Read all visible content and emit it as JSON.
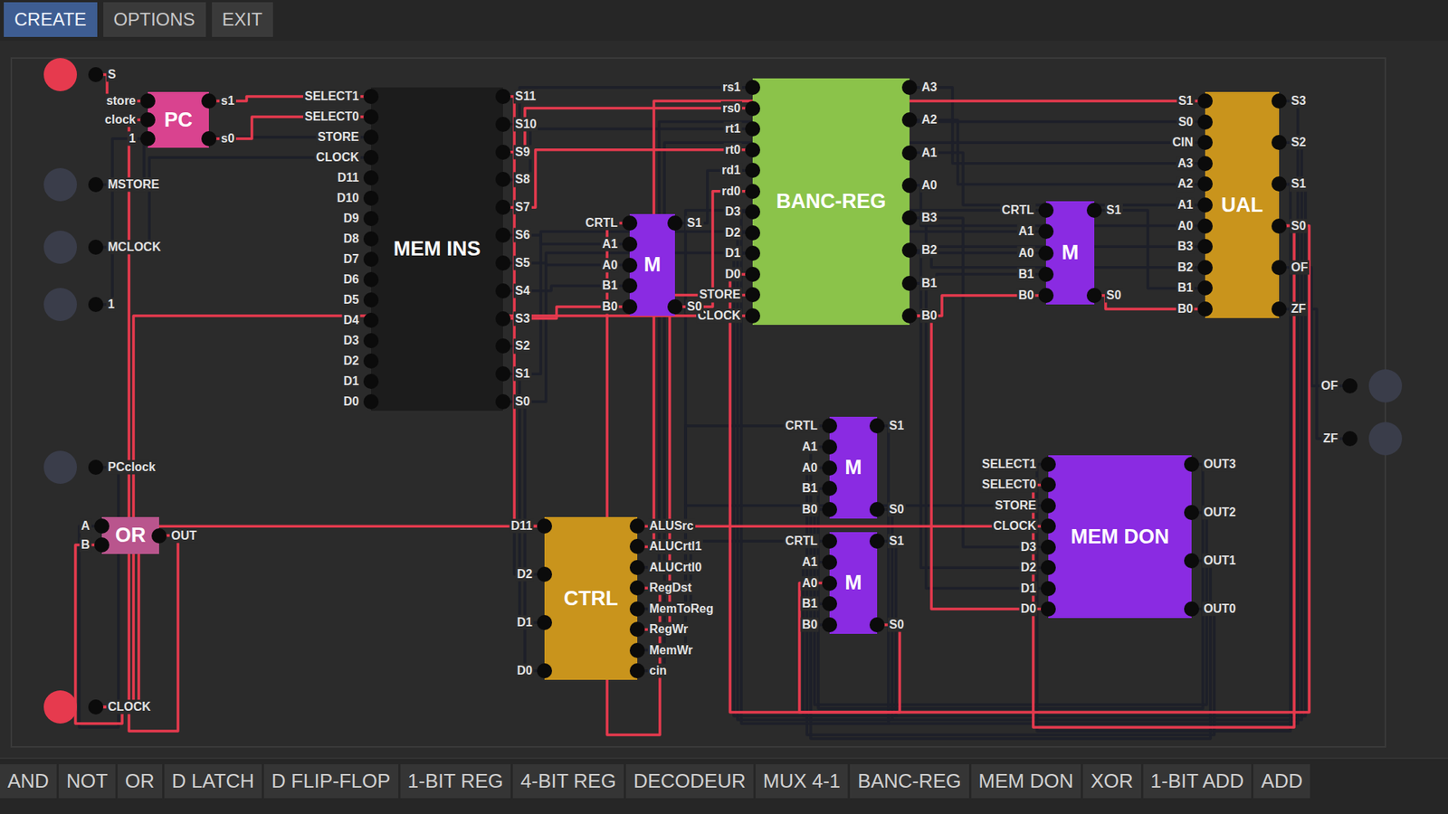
{
  "menu": [
    {
      "label": "CREATE",
      "selected": true
    },
    {
      "label": "OPTIONS",
      "selected": false
    },
    {
      "label": "EXIT",
      "selected": false
    }
  ],
  "inputs": [
    {
      "label": "S",
      "on": true
    },
    {
      "label": "MSTORE",
      "on": false
    },
    {
      "label": "MCLOCK",
      "on": false
    },
    {
      "label": "1",
      "on": false
    },
    {
      "label": "PCclock",
      "on": false
    },
    {
      "label": "CLOCK",
      "on": true
    }
  ],
  "outputs": [
    {
      "label": "OF",
      "on": false
    },
    {
      "label": "ZF",
      "on": false
    }
  ],
  "components": [
    {
      "label": "PC",
      "color": "#d9438f",
      "inputs": [
        "store",
        "clock",
        "1"
      ],
      "outputs": [
        "s1",
        "s0"
      ]
    },
    {
      "label": "OR",
      "color": "#b9558d",
      "inputs": [
        "A",
        "B"
      ],
      "outputs": [
        "OUT"
      ]
    },
    {
      "label": "MEM INS",
      "color": "#1c1c1c",
      "inputs": [
        "SELECT1",
        "SELECT0",
        "STORE",
        "CLOCK",
        "D11",
        "D10",
        "D9",
        "D8",
        "D7",
        "D6",
        "D5",
        "D4",
        "D3",
        "D2",
        "D1",
        "D0"
      ],
      "outputs": [
        "S11",
        "S10",
        "S9",
        "S8",
        "S7",
        "S6",
        "S5",
        "S4",
        "S3",
        "S2",
        "S1",
        "S0"
      ]
    },
    {
      "label": "BANC-REG",
      "color": "#8bc34a",
      "inputs": [
        "rs1",
        "rs0",
        "rt1",
        "rt0",
        "rd1",
        "rd0",
        "D3",
        "D2",
        "D1",
        "D0",
        "STORE",
        "CLOCK"
      ],
      "outputs": [
        "A3",
        "A2",
        "A1",
        "A0",
        "B3",
        "B2",
        "B1",
        "B0"
      ]
    },
    {
      "label": "M",
      "color": "#8a2be2",
      "inputs": [
        "CRTL",
        "A1",
        "A0",
        "B1",
        "B0"
      ],
      "outputs": [
        "S1",
        "S0"
      ]
    },
    {
      "label": "M",
      "color": "#8a2be2",
      "inputs": [
        "CRTL",
        "A1",
        "A0",
        "B1",
        "B0"
      ],
      "outputs": [
        "S1",
        "S0"
      ]
    },
    {
      "label": "UAL",
      "color": "#c9941c",
      "inputs": [
        "S1",
        "S0",
        "CIN",
        "A3",
        "A2",
        "A1",
        "A0",
        "B3",
        "B2",
        "B1",
        "B0"
      ],
      "outputs": [
        "S3",
        "S2",
        "S1",
        "S0",
        "OF",
        "ZF"
      ]
    },
    {
      "label": "M",
      "color": "#8a2be2",
      "inputs": [
        "CRTL",
        "A1",
        "A0",
        "B1",
        "B0"
      ],
      "outputs": [
        "S1",
        "S0"
      ]
    },
    {
      "label": "M",
      "color": "#8a2be2",
      "inputs": [
        "CRTL",
        "A1",
        "A0",
        "B1",
        "B0"
      ],
      "outputs": [
        "S1",
        "S0"
      ]
    },
    {
      "label": "MEM DON",
      "color": "#8a2be2",
      "inputs": [
        "SELECT1",
        "SELECT0",
        "STORE",
        "CLOCK",
        "D3",
        "D2",
        "D1",
        "D0"
      ],
      "outputs": [
        "OUT3",
        "OUT2",
        "OUT1",
        "OUT0"
      ]
    },
    {
      "label": "CTRL",
      "color": "#c9941c",
      "inputs": [
        "D11",
        "D2",
        "D1",
        "D0"
      ],
      "outputs": [
        "ALUSrc",
        "ALUCrtl1",
        "ALUCrtl0",
        "RegDst",
        "MemToReg",
        "RegWr",
        "MemWr",
        "cin"
      ]
    }
  ],
  "wires": [
    {
      "from": "in:0",
      "to": "0:store",
      "on": true
    },
    {
      "from": "in:3",
      "to": "0:1",
      "on": false
    },
    {
      "from": "1:OUT",
      "to": "0:clock",
      "on": true
    },
    {
      "from": "in:4",
      "to": "1:A",
      "on": false
    },
    {
      "from": "in:5",
      "to": "1:B",
      "on": true
    },
    {
      "from": "0:s1",
      "to": "2:SELECT1",
      "on": true
    },
    {
      "from": "0:s0",
      "to": "2:SELECT0",
      "on": true
    },
    {
      "from": "in:1",
      "to": "2:STORE",
      "on": false
    },
    {
      "from": "in:2",
      "to": "2:CLOCK",
      "on": false
    },
    {
      "from": "2:S11",
      "to": "10:D11",
      "on": true
    },
    {
      "from": "2:S10",
      "to": "3:rs1",
      "on": false
    },
    {
      "from": "2:S9",
      "to": "3:rs0",
      "on": true
    },
    {
      "from": "2:S8",
      "to": "3:rt1",
      "on": false
    },
    {
      "from": "2:S7",
      "to": "3:rt0",
      "on": true
    },
    {
      "from": "2:S6",
      "to": "4:A1",
      "on": false
    },
    {
      "from": "2:S5",
      "to": "4:A0",
      "on": false
    },
    {
      "from": "2:S4",
      "to": "4:B1",
      "on": false
    },
    {
      "from": "2:S3",
      "to": "4:B0",
      "on": true
    },
    {
      "from": "2:S2",
      "to": "10:D2",
      "on": false
    },
    {
      "from": "2:S1",
      "to": "10:D1",
      "on": false
    },
    {
      "from": "2:S0",
      "to": "10:D0",
      "on": false
    },
    {
      "from": "10:RegDst",
      "to": "4:CRTL",
      "on": true
    },
    {
      "from": "4:S1",
      "to": "3:rd1",
      "on": false
    },
    {
      "from": "4:S0",
      "to": "3:rd0",
      "on": true
    },
    {
      "from": "3:A3",
      "to": "6:A3",
      "on": false
    },
    {
      "from": "3:A2",
      "to": "6:A2",
      "on": false
    },
    {
      "from": "3:A1",
      "to": "6:A1",
      "on": false
    },
    {
      "from": "3:A0",
      "to": "6:A0",
      "on": false
    },
    {
      "from": "3:B3",
      "to": "6:B3",
      "on": false
    },
    {
      "from": "3:B2",
      "to": "6:B2",
      "on": false
    },
    {
      "from": "3:B1",
      "to": "5:B1",
      "on": false
    },
    {
      "from": "3:B0",
      "to": "5:B0",
      "on": true
    },
    {
      "from": "2:S1",
      "to": "5:A1",
      "on": false
    },
    {
      "from": "2:S0",
      "to": "5:A0",
      "on": false
    },
    {
      "from": "10:ALUSrc",
      "to": "5:CRTL",
      "on": false
    },
    {
      "from": "5:S1",
      "to": "6:B1",
      "on": false
    },
    {
      "from": "5:S0",
      "to": "6:B0",
      "on": true
    },
    {
      "from": "10:ALUCrtl1",
      "to": "6:S1",
      "on": true
    },
    {
      "from": "10:ALUCrtl0",
      "to": "6:S0",
      "on": false
    },
    {
      "from": "10:cin",
      "to": "6:CIN",
      "on": false
    },
    {
      "from": "6:OF",
      "to": "out:0",
      "on": false
    },
    {
      "from": "6:ZF",
      "to": "out:1",
      "on": false
    },
    {
      "from": "6:S1",
      "to": "9:SELECT1",
      "on": false
    },
    {
      "from": "6:S0",
      "to": "9:SELECT0",
      "on": true
    },
    {
      "from": "6:S3",
      "to": "7:A1",
      "on": false
    },
    {
      "from": "6:S2",
      "to": "7:A0",
      "on": false
    },
    {
      "from": "6:S1",
      "to": "8:A1",
      "on": false
    },
    {
      "from": "6:S0",
      "to": "8:A0",
      "on": true
    },
    {
      "from": "9:OUT3",
      "to": "7:B1",
      "on": false
    },
    {
      "from": "9:OUT2",
      "to": "7:B0",
      "on": false
    },
    {
      "from": "9:OUT1",
      "to": "8:B1",
      "on": false
    },
    {
      "from": "9:OUT0",
      "to": "8:B0",
      "on": false
    },
    {
      "from": "10:MemToReg",
      "to": "7:CRTL",
      "on": false
    },
    {
      "from": "10:MemToReg",
      "to": "8:CRTL",
      "on": false
    },
    {
      "from": "7:S1",
      "to": "3:D3",
      "on": false
    },
    {
      "from": "7:S0",
      "to": "3:D2",
      "on": false
    },
    {
      "from": "8:S1",
      "to": "3:D1",
      "on": false
    },
    {
      "from": "8:S0",
      "to": "3:D0",
      "on": true
    },
    {
      "from": "10:RegWr",
      "to": "3:STORE",
      "on": true
    },
    {
      "from": "in:5",
      "to": "3:CLOCK",
      "on": true
    },
    {
      "from": "in:5",
      "to": "9:CLOCK",
      "on": true
    },
    {
      "from": "10:MemWr",
      "to": "9:STORE",
      "on": false
    },
    {
      "from": "3:B3",
      "to": "9:D3",
      "on": false
    },
    {
      "from": "3:B2",
      "to": "9:D2",
      "on": false
    },
    {
      "from": "3:B1",
      "to": "9:D1",
      "on": false
    },
    {
      "from": "3:B0",
      "to": "9:D0",
      "on": true
    }
  ],
  "toolbar": [
    "AND",
    "NOT",
    "OR",
    "D LATCH",
    "D FLIP-FLOP",
    "1-BIT REG",
    "4-BIT REG",
    "DECODEUR",
    "MUX 4-1",
    "BANC-REG",
    "MEM DON",
    "XOR",
    "1-BIT ADD",
    "ADD"
  ]
}
